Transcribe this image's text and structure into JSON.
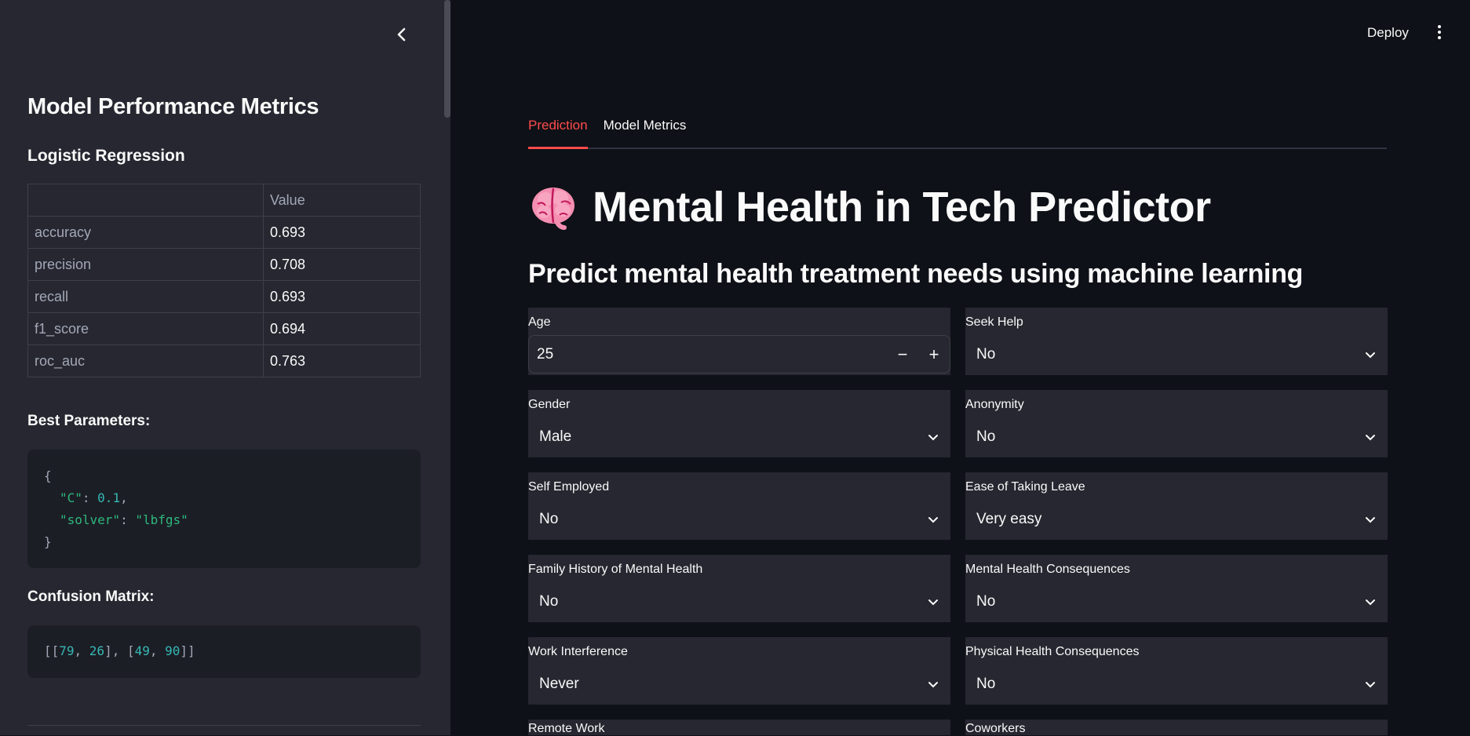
{
  "sidebar": {
    "title": "Model Performance Metrics",
    "model_name": "Logistic Regression",
    "table": {
      "header": [
        "",
        "Value"
      ],
      "rows": [
        {
          "metric": "accuracy",
          "value": "0.693"
        },
        {
          "metric": "precision",
          "value": "0.708"
        },
        {
          "metric": "recall",
          "value": "0.693"
        },
        {
          "metric": "f1_score",
          "value": "0.694"
        },
        {
          "metric": "roc_auc",
          "value": "0.763"
        }
      ]
    },
    "best_params_label": "Best Parameters:",
    "best_params": {
      "open": "{",
      "line1_key": "\"C\"",
      "line1_val": "0.1",
      "line2_key": "\"solver\"",
      "line2_val": "\"lbfgs\"",
      "close": "}"
    },
    "confusion_label": "Confusion Matrix:",
    "confusion": {
      "a": "79",
      "b": "26",
      "c": "49",
      "d": "90"
    }
  },
  "header": {
    "deploy_label": "Deploy"
  },
  "tabs": [
    {
      "label": "Prediction",
      "active": true
    },
    {
      "label": "Model Metrics",
      "active": false
    }
  ],
  "main": {
    "title": "Mental Health in Tech Predictor",
    "subtitle": "Predict mental health treatment needs using machine learning",
    "fields": {
      "age": {
        "label": "Age",
        "value": "25"
      },
      "seek_help": {
        "label": "Seek Help",
        "value": "No"
      },
      "gender": {
        "label": "Gender",
        "value": "Male"
      },
      "anonymity": {
        "label": "Anonymity",
        "value": "No"
      },
      "self_employed": {
        "label": "Self Employed",
        "value": "No"
      },
      "leave": {
        "label": "Ease of Taking Leave",
        "value": "Very easy"
      },
      "family_history": {
        "label": "Family History of Mental Health",
        "value": "No"
      },
      "mh_consequence": {
        "label": "Mental Health Consequences",
        "value": "No"
      },
      "work_interfere": {
        "label": "Work Interference",
        "value": "Never"
      },
      "phys_consequence": {
        "label": "Physical Health Consequences",
        "value": "No"
      },
      "remote_work": {
        "label": "Remote Work"
      },
      "coworkers": {
        "label": "Coworkers"
      }
    }
  },
  "icons": {
    "collapse": "chevron-left-icon",
    "menu": "kebab-menu-icon",
    "title_emoji": "brain-icon",
    "dropdown": "chevron-down-icon"
  },
  "colors": {
    "accent": "#ff4b4b",
    "sidebar_bg": "#262730",
    "main_bg": "#0e1117",
    "code_green": "#2db87d"
  }
}
